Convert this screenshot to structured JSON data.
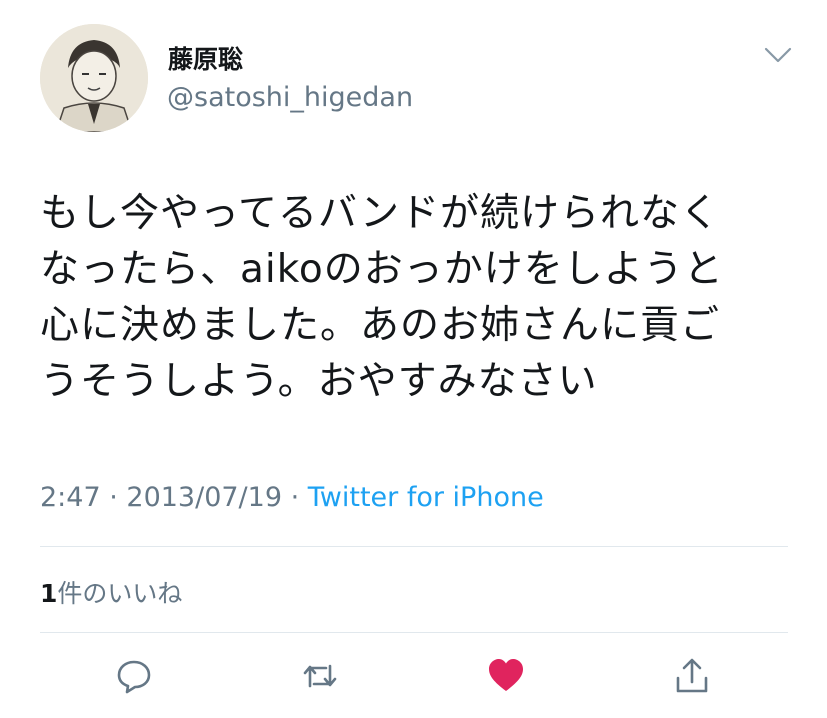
{
  "author": {
    "display_name": "藤原聡",
    "handle": "@satoshi_higedan"
  },
  "tweet": {
    "lines": [
      "もし今やってるバンドが続けられなく",
      "なったら、aikoのおっかけをしようと",
      "心に決めました。あのお姉さんに貢ご",
      "うそうしよう。おやすみなさい"
    ],
    "time": "2:47",
    "date": "2013/07/19",
    "separator": " · ",
    "source": "Twitter for iPhone"
  },
  "stats": {
    "likes_count": "1",
    "likes_label": "件のいいね"
  },
  "actions": {
    "reply_icon": "reply-icon",
    "retweet_icon": "retweet-icon",
    "like_icon": "heart-icon",
    "share_icon": "share-icon",
    "like_color": "#e0245e",
    "icon_color": "#657786"
  },
  "colors": {
    "text": "#14171a",
    "secondary": "#657786",
    "link": "#1da1f2",
    "divider": "#e1e8ed"
  }
}
